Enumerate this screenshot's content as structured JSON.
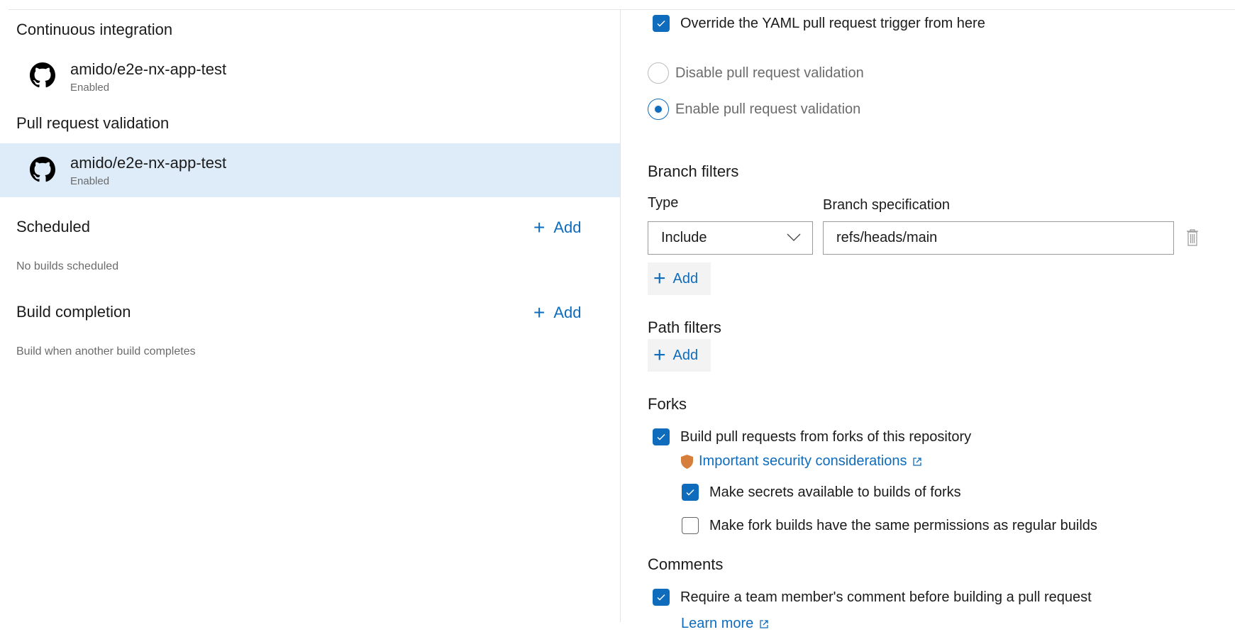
{
  "left": {
    "continuous_integration": {
      "title": "Continuous integration",
      "repo": "amido/e2e-nx-app-test",
      "status": "Enabled"
    },
    "pull_request_validation": {
      "title": "Pull request validation",
      "repo": "amido/e2e-nx-app-test",
      "status": "Enabled"
    },
    "scheduled": {
      "title": "Scheduled",
      "add_label": "Add",
      "empty": "No builds scheduled"
    },
    "build_completion": {
      "title": "Build completion",
      "add_label": "Add",
      "description": "Build when another build completes"
    }
  },
  "right": {
    "override": {
      "label": "Override the YAML pull request trigger from here",
      "checked": true
    },
    "validation_options": [
      {
        "label": "Disable pull request validation",
        "selected": false
      },
      {
        "label": "Enable pull request validation",
        "selected": true
      }
    ],
    "branch_filters": {
      "title": "Branch filters",
      "type_label": "Type",
      "spec_label": "Branch specification",
      "type_value": "Include",
      "spec_value": "refs/heads/main",
      "add_label": "Add"
    },
    "path_filters": {
      "title": "Path filters",
      "add_label": "Add"
    },
    "forks": {
      "title": "Forks",
      "build_forks": {
        "label": "Build pull requests from forks of this repository",
        "checked": true
      },
      "security_link": "Important security considerations",
      "secrets": {
        "label": "Make secrets available to builds of forks",
        "checked": true
      },
      "permissions": {
        "label": "Make fork builds have the same permissions as regular builds",
        "checked": false
      }
    },
    "comments": {
      "title": "Comments",
      "require": {
        "label": "Require a team member's comment before building a pull request",
        "checked": true
      },
      "learn_more": "Learn more"
    }
  },
  "colors": {
    "accent": "#0f6cbd",
    "selected_row": "#deecf9",
    "shield": "#d67f3c"
  }
}
